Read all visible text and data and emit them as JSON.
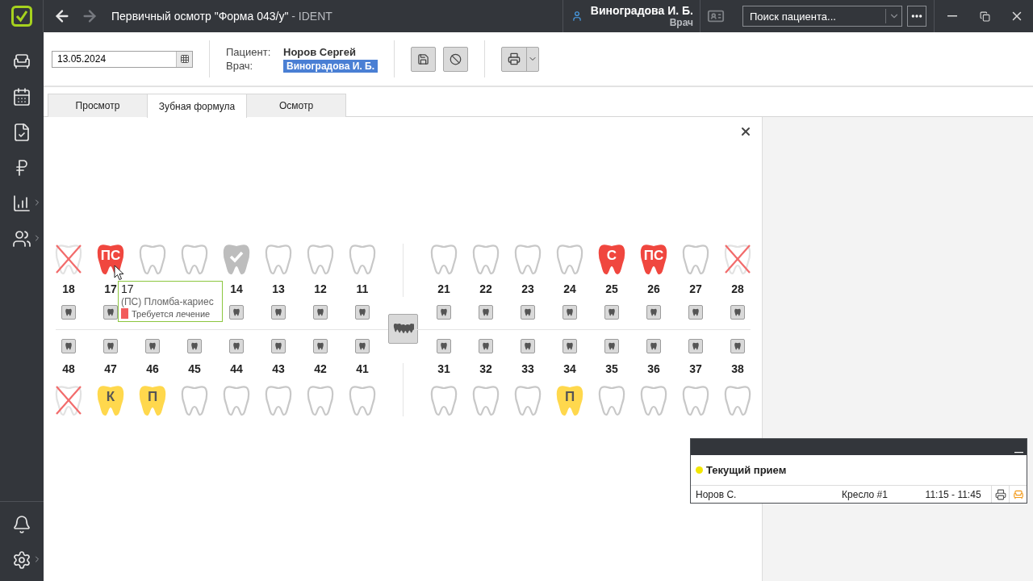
{
  "title_bar": {
    "back": {
      "disabled": false
    },
    "forward": {
      "disabled": true
    },
    "title": "Первичный осмотр \"Форма 043/у\"",
    "app_name": " - IDENT",
    "user": {
      "name": "Виноградова И. Б.",
      "role": "Врач"
    },
    "search": {
      "placeholder": "Поиск пациента..."
    }
  },
  "sidebar": {
    "items": [
      {
        "kind": "chair",
        "submenu": false
      },
      {
        "kind": "calendar",
        "submenu": false
      },
      {
        "kind": "documents",
        "submenu": false
      },
      {
        "kind": "payments",
        "submenu": false
      },
      {
        "kind": "reports",
        "submenu": true
      },
      {
        "kind": "people",
        "submenu": true
      }
    ],
    "bottom_items": [
      {
        "kind": "bell",
        "submenu": false
      },
      {
        "kind": "settings",
        "submenu": true
      }
    ]
  },
  "toolbar": {
    "date": "13.05.2024",
    "patient_label": "Пациент:",
    "patient": "Норов Сергей",
    "doctor_label": "Врач:",
    "doctor": "Виноградова И. Б."
  },
  "tabs": [
    {
      "label": "Просмотр",
      "selected": false
    },
    {
      "label": "Зубная формула",
      "selected": true
    },
    {
      "label": "Осмотр",
      "selected": false
    }
  ],
  "dental_chart": {
    "upper_left": [
      {
        "number": "18",
        "kind": "missing"
      },
      {
        "number": "17",
        "kind": "problem",
        "code": "ПС"
      },
      {
        "kind": "healthy"
      },
      {
        "kind": "healthy"
      },
      {
        "number": "14",
        "kind": "treated"
      },
      {
        "number": "13",
        "kind": "healthy"
      },
      {
        "number": "12",
        "kind": "healthy"
      },
      {
        "number": "11",
        "kind": "healthy"
      }
    ],
    "upper_right": [
      {
        "number": "21",
        "kind": "healthy"
      },
      {
        "number": "22",
        "kind": "healthy"
      },
      {
        "number": "23",
        "kind": "healthy"
      },
      {
        "number": "24",
        "kind": "healthy"
      },
      {
        "number": "25",
        "kind": "problem",
        "code": "С"
      },
      {
        "number": "26",
        "kind": "problem",
        "code": "ПС"
      },
      {
        "number": "27",
        "kind": "healthy"
      },
      {
        "number": "28",
        "kind": "missing"
      }
    ],
    "lower_left": [
      {
        "number": "48",
        "kind": "missing"
      },
      {
        "number": "47",
        "kind": "planned",
        "code": "К"
      },
      {
        "number": "46",
        "kind": "planned",
        "code": "П"
      },
      {
        "number": "45",
        "kind": "healthy"
      },
      {
        "number": "44",
        "kind": "healthy"
      },
      {
        "number": "43",
        "kind": "healthy"
      },
      {
        "number": "42",
        "kind": "healthy"
      },
      {
        "number": "41",
        "kind": "healthy"
      }
    ],
    "lower_right": [
      {
        "number": "31",
        "kind": "healthy"
      },
      {
        "number": "32",
        "kind": "healthy"
      },
      {
        "number": "33",
        "kind": "healthy"
      },
      {
        "number": "34",
        "kind": "planned",
        "code": "П"
      },
      {
        "number": "35",
        "kind": "healthy"
      },
      {
        "number": "36",
        "kind": "healthy"
      },
      {
        "number": "37",
        "kind": "healthy"
      },
      {
        "number": "38",
        "kind": "healthy"
      }
    ],
    "tooltip": {
      "tooth": "17",
      "diagnosis": "(ПС) Пломба-кариес",
      "status": "Требуется лечение",
      "color": "#f25c5c"
    }
  },
  "current_visit": {
    "title": "Текущий прием",
    "color": "#f2e600",
    "patient": "Норов С.",
    "chair": "Кресло #1",
    "time": "11:15 - 11:45"
  }
}
